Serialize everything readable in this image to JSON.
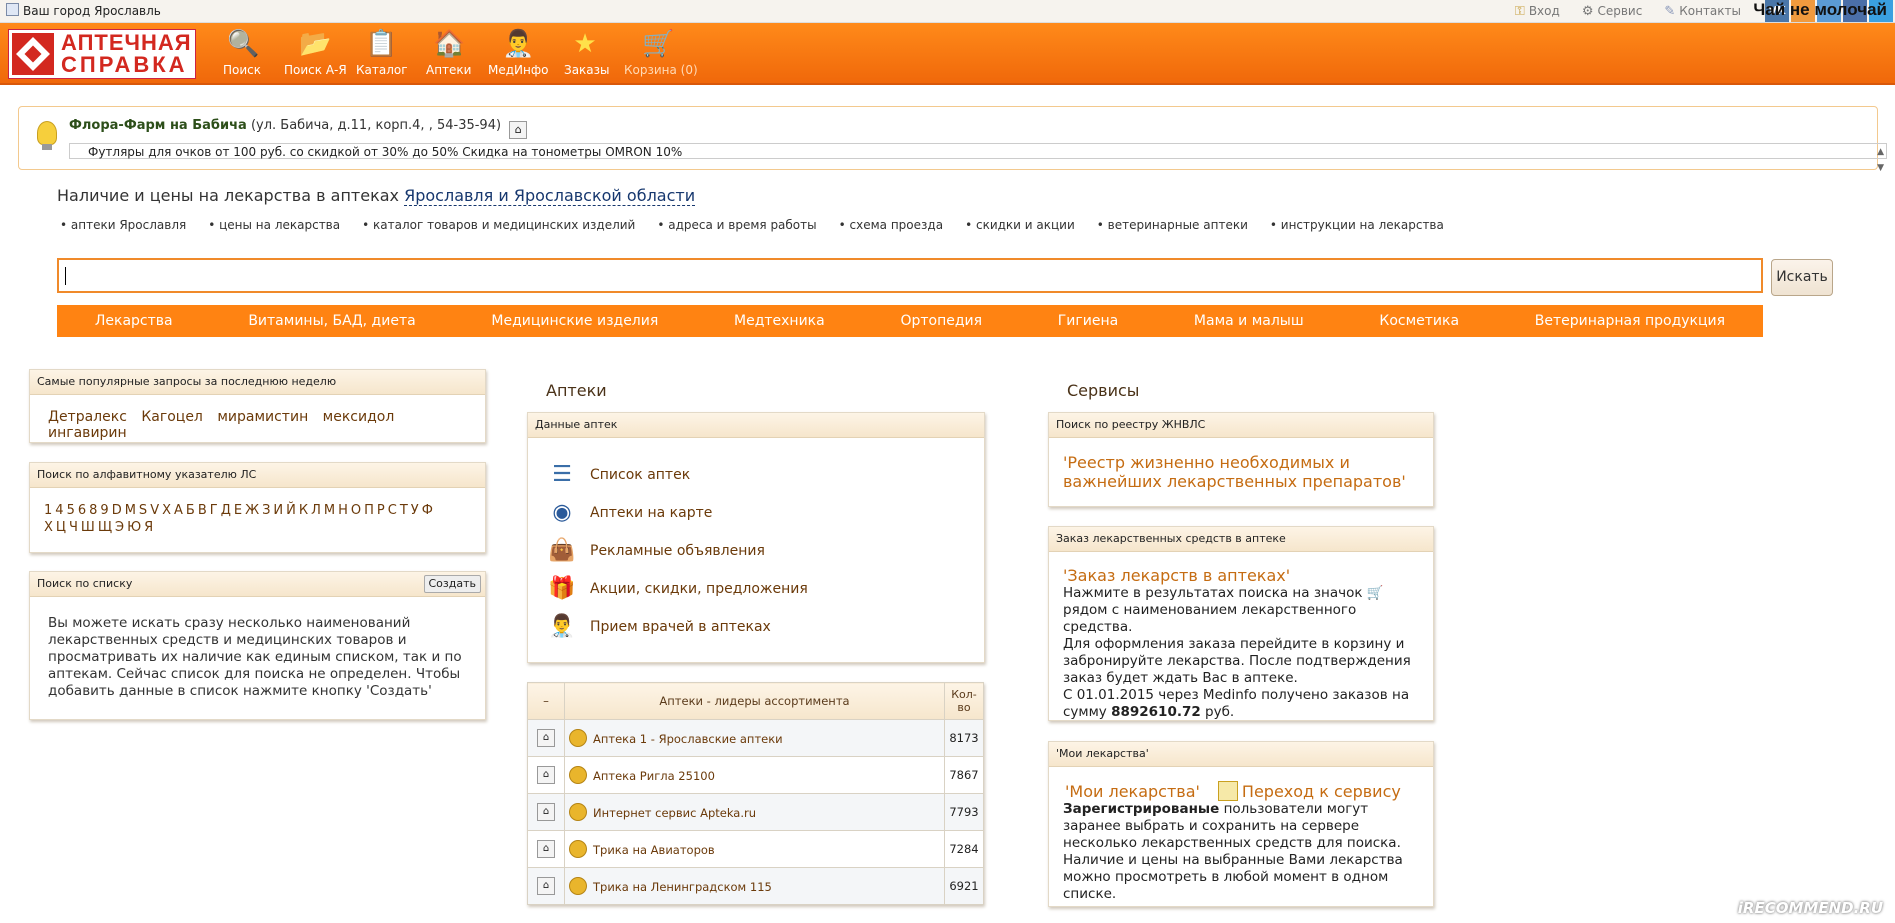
{
  "topbar": {
    "city_label": "Ваш город",
    "city_name": "Ярославль",
    "login": "Вход",
    "service": "Сервис",
    "contacts": "Контакты",
    "banner_text": "Чай не молочай"
  },
  "logo": {
    "line1": "АПТЕЧНАЯ",
    "line2": "СПРАВКА"
  },
  "nav": [
    {
      "label": "Поиск",
      "icon": "magnifier-icon"
    },
    {
      "label": "Поиск А-Я",
      "icon": "binoculars-folder-icon"
    },
    {
      "label": "Каталог",
      "icon": "catalog-list-icon"
    },
    {
      "label": "Аптеки",
      "icon": "pharmacy-house-icon"
    },
    {
      "label": "МедИнфо",
      "icon": "doctor-icon"
    },
    {
      "label": "Заказы",
      "icon": "star-icon"
    },
    {
      "label": "Корзина (0)",
      "icon": "cart-icon"
    }
  ],
  "promo": {
    "name": "Флора-Фарм на Бабича",
    "address": "(ул. Бабича, д.11, корп.4, , 54-35-94)",
    "ticker": "Футляры для очков от 100 руб. со скидкой от 30% до 50% Скидка на тонометры OMRON 10%"
  },
  "tagline": {
    "text": "Наличие и цены на лекарства в аптеках",
    "region": "Ярославля и Ярославской области"
  },
  "quick_links": [
    "аптеки Ярославля",
    "цены на лекарства",
    "каталог товаров и медицинских изделий",
    "адреса и время работы",
    "схема проезда",
    "скидки и акции",
    "ветеринарные аптеки",
    "инструкции на лекарства"
  ],
  "search": {
    "value": "",
    "button": "Искать"
  },
  "categories": [
    "Лекарства",
    "Витамины, БАД, диета",
    "Медицинские изделия",
    "Медтехника",
    "Ортопедия",
    "Гигиена",
    "Мама и малыш",
    "Косметика",
    "Ветеринарная продукция"
  ],
  "popular": {
    "title": "Самые популярные запросы за последнюю неделю",
    "items": [
      "Детралекс",
      "Кагоцел",
      "мирамистин",
      "мексидол",
      "ингавирин"
    ]
  },
  "alphabet": {
    "title": "Поиск по алфавитному указателю ЛС",
    "row1": [
      "1",
      "4",
      "5",
      "6",
      "8",
      "9",
      "D",
      "M",
      "S",
      "V",
      "X",
      "А",
      "Б",
      "В",
      "Г",
      "Д",
      "Е",
      "Ж",
      "З",
      "И",
      "Й",
      "К",
      "Л",
      "М",
      "Н",
      "О",
      "П",
      "Р",
      "С",
      "Т",
      "У",
      "Ф"
    ],
    "row2": [
      "Х",
      "Ц",
      "Ч",
      "Ш",
      "Щ",
      "Э",
      "Ю",
      "Я"
    ]
  },
  "list_search": {
    "title": "Поиск по списку",
    "create": "Создать",
    "text": "Вы можете искать сразу несколько наименований лекарственных средств и медицинских товаров и просматривать их наличие как единым списком, так и по аптекам. Сейчас список для поиска не определен. Чтобы добавить данные в список нажмите кнопку 'Создать'"
  },
  "pharmacies": {
    "section_title": "Аптеки",
    "box_title": "Данные аптек",
    "links": [
      {
        "label": "Список аптек",
        "icon": "list-icon"
      },
      {
        "label": "Аптеки на карте",
        "icon": "map-compass-icon"
      },
      {
        "label": "Рекламные объявления",
        "icon": "bag-icon"
      },
      {
        "label": "Акции, скидки, предложения",
        "icon": "gift-icon"
      },
      {
        "label": "Прием врачей в аптеках",
        "icon": "doctor-icon"
      }
    ],
    "leaders": {
      "col_minus": "–",
      "col_title": "Аптеки - лидеры ассортимента",
      "col_count": "Кол-во",
      "rows": [
        {
          "name": "Аптека 1 - Ярославские аптеки",
          "count": "8173"
        },
        {
          "name": "Аптека Ригла 25100",
          "count": "7867"
        },
        {
          "name": "Интернет сервис Apteka.ru",
          "count": "7793"
        },
        {
          "name": "Трика на Авиаторов",
          "count": "7284"
        },
        {
          "name": "Трика на Ленинградском 115",
          "count": "6921"
        }
      ]
    }
  },
  "services": {
    "section_title": "Сервисы",
    "zhnvls": {
      "title": "Поиск по реестру ЖНВЛС",
      "link": "'Реестр жизненно необходимых и важнейших лекарственных препаратов'"
    },
    "order": {
      "title": "Заказ лекарственных средств в аптеке",
      "link": "'Заказ лекарств в аптеках'",
      "p1a": "Нажмите в результатах поиска на значок",
      "p1b": "рядом с наименованием лекарственного средства.",
      "p2": "Для оформления заказа перейдите в корзину и забронируйте лекарства. После подтверждения заказ будет ждать Вас в аптеке.",
      "p3a": "С 01.01.2015 через Medinfo получено заказов на сумму",
      "amount": "8892610.72",
      "p3b": "руб."
    },
    "my_meds": {
      "title": "'Мои лекарства'",
      "link": "'Мои лекарства'",
      "go_link": "Переход к сервису",
      "bold": "Зарегистрированые",
      "text": "пользователи могут заранее выбрать и сохранить на сервере несколько лекарственных средств для поиска. Наличие и цены на выбранные Вами лекарства можно просмотреть в любой момент в одном списке."
    }
  },
  "watermark": "iRECOMMEND.RU",
  "colors": {
    "accent": "#ff8312",
    "header": "#f0680a",
    "link": "#6b3a0a",
    "logo_red": "#d3281f"
  }
}
